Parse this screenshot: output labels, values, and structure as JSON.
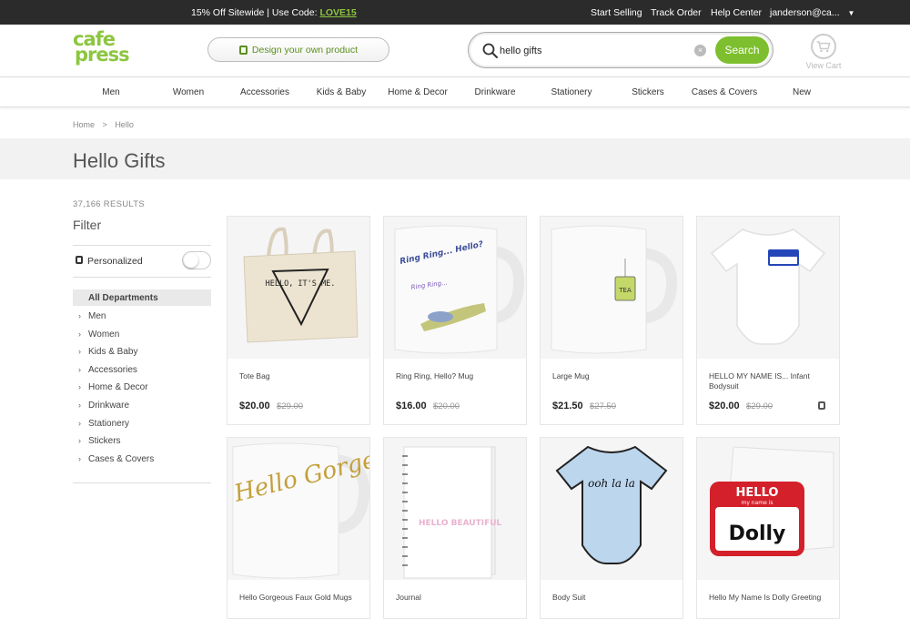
{
  "topbar": {
    "promo_text": "15% Off Sitewide | Use Code:",
    "promo_code": "LOVE15",
    "links": [
      "Start Selling",
      "Track Order",
      "Help Center"
    ],
    "account": "janderson@ca...",
    "account_chevron": "▼"
  },
  "header": {
    "logo_line1": "cafe",
    "logo_line2": "press",
    "design_button": "Design your own product",
    "search_value": "hello gifts",
    "search_button": "Search",
    "clear_glyph": "×",
    "cart_label": "View Cart"
  },
  "nav": {
    "items": [
      "Men",
      "Women",
      "Accessories",
      "Kids & Baby",
      "Home & Decor",
      "Drinkware",
      "Stationery",
      "Stickers",
      "Cases & Covers",
      "New"
    ]
  },
  "breadcrumb": {
    "home": "Home",
    "separator": ">",
    "current": "Hello"
  },
  "page": {
    "title": "Hello Gifts"
  },
  "sidebar": {
    "results_count": "37,166 RESULTS",
    "filter_label": "Filter",
    "personalized_label": "Personalized",
    "personalized_on": false,
    "all_departments": "All Departments",
    "departments": [
      "Men",
      "Women",
      "Kids & Baby",
      "Accessories",
      "Home & Decor",
      "Drinkware",
      "Stationery",
      "Stickers",
      "Cases & Covers"
    ],
    "chevron": "›"
  },
  "products": [
    {
      "title": "Tote Bag",
      "price": "$20.00",
      "old_price": "$29.00",
      "personalizable": false,
      "image_text": "HELLO, IT'S ME."
    },
    {
      "title": "Ring Ring, Hello? Mug",
      "price": "$16.00",
      "old_price": "$20.00",
      "personalizable": false,
      "image_text": "Ring Ring... Hello?"
    },
    {
      "title": "Large Mug",
      "price": "$21.50",
      "old_price": "$27.50",
      "personalizable": false,
      "image_text": "TEA"
    },
    {
      "title": "HELLO MY NAME IS... Infant Bodysuit",
      "price": "$20.00",
      "old_price": "$29.00",
      "personalizable": true,
      "image_text": ""
    },
    {
      "title": "Hello Gorgeous Faux Gold Mugs",
      "price": "",
      "old_price": "",
      "personalizable": false,
      "image_text": "Hello Gorgeous"
    },
    {
      "title": "Journal",
      "price": "",
      "old_price": "",
      "personalizable": false,
      "image_text": "HELLO BEAUTIFUL"
    },
    {
      "title": "Body Suit",
      "price": "",
      "old_price": "",
      "personalizable": false,
      "image_text": "ooh la la"
    },
    {
      "title": "Hello My Name Is Dolly Greeting",
      "price": "",
      "old_price": "",
      "personalizable": false,
      "image_text_1": "HELLO",
      "image_text_2": "my name is",
      "image_text_3": "Dolly"
    }
  ],
  "colors": {
    "brand_green": "#8cc63f",
    "search_button": "#7dbf2e",
    "topbar": "#2b2b2b",
    "band": "#f2f2f2"
  }
}
